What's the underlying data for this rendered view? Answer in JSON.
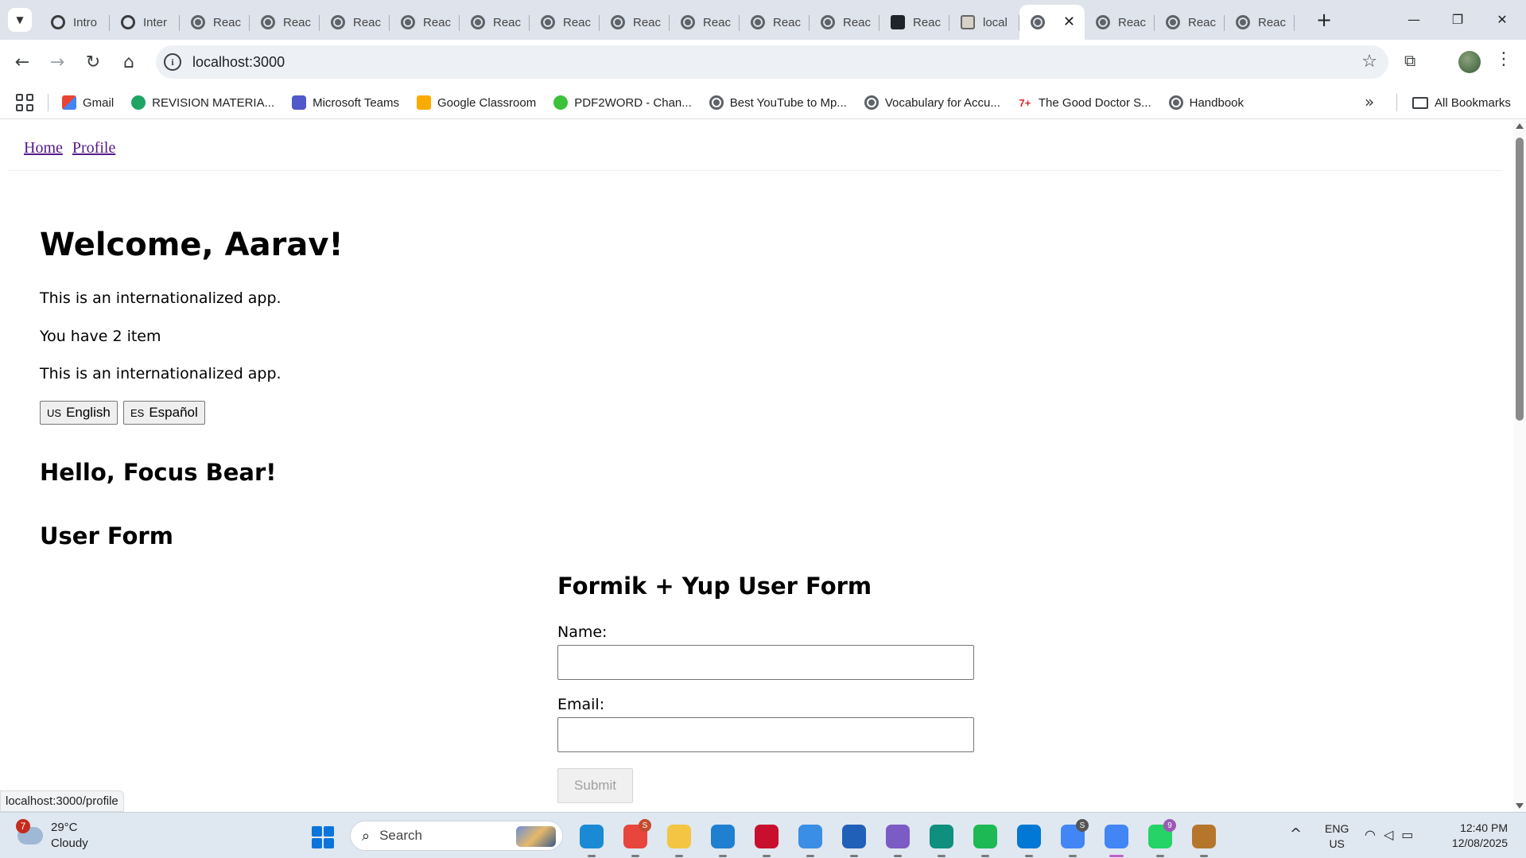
{
  "browser": {
    "tabs": [
      {
        "label": "Intro",
        "favicon": "openai-icon"
      },
      {
        "label": "Inter",
        "favicon": "openai-icon"
      },
      {
        "label": "Reac",
        "favicon": "globe-icon"
      },
      {
        "label": "Reac",
        "favicon": "globe-icon"
      },
      {
        "label": "Reac",
        "favicon": "globe-icon"
      },
      {
        "label": "Reac",
        "favicon": "globe-icon"
      },
      {
        "label": "Reac",
        "favicon": "globe-icon"
      },
      {
        "label": "Reac",
        "favicon": "globe-icon"
      },
      {
        "label": "Reac",
        "favicon": "globe-icon"
      },
      {
        "label": "Reac",
        "favicon": "globe-icon"
      },
      {
        "label": "Reac",
        "favicon": "globe-icon"
      },
      {
        "label": "Reac",
        "favicon": "globe-icon"
      },
      {
        "label": "Reac",
        "favicon": "react-icon"
      },
      {
        "label": "local",
        "favicon": "local-icon"
      },
      {
        "label": "",
        "favicon": "globe-icon",
        "active": true
      },
      {
        "label": "Reac",
        "favicon": "globe-icon"
      },
      {
        "label": "Reac",
        "favicon": "globe-icon"
      },
      {
        "label": "Reac",
        "favicon": "globe-icon"
      }
    ],
    "address": "localhost:3000",
    "bookmarks": [
      {
        "label": "Gmail",
        "icon": "gmail"
      },
      {
        "label": "REVISION MATERIA...",
        "icon": "green"
      },
      {
        "label": "Microsoft Teams",
        "icon": "teams"
      },
      {
        "label": "Google Classroom",
        "icon": "class"
      },
      {
        "label": "PDF2WORD - Chan...",
        "icon": "pdf"
      },
      {
        "label": "Best YouTube to Mp...",
        "icon": "world"
      },
      {
        "label": "Vocabulary for Accu...",
        "icon": "world"
      },
      {
        "label": "The Good Doctor S...",
        "icon": "tgd"
      },
      {
        "label": "Handbook",
        "icon": "world"
      }
    ],
    "all_bookmarks": "All Bookmarks",
    "status_url": "localhost:3000/profile"
  },
  "page": {
    "nav": {
      "home": "Home",
      "profile": "Profile"
    },
    "welcome": "Welcome, Aarav!",
    "intro": "This is an internationalized app.",
    "items": "You have 2 item",
    "intro2": "This is an internationalized app.",
    "lang_buttons": {
      "english": {
        "flag": "US",
        "label": "English"
      },
      "spanish": {
        "flag": "ES",
        "label": "Español"
      }
    },
    "hello": "Hello, Focus Bear!",
    "user_form_heading": "User Form",
    "form": {
      "title": "Formik + Yup User Form",
      "name_label": "Name:",
      "name_value": "",
      "email_label": "Email:",
      "email_value": "",
      "submit_label": "Submit"
    }
  },
  "taskbar": {
    "weather": {
      "temp": "29°C",
      "condition": "Cloudy",
      "badge": "7"
    },
    "search_placeholder": "Search",
    "apps": [
      {
        "name": "edge-icon",
        "color": "#1a8ad4"
      },
      {
        "name": "chrome-profile-icon",
        "color": "#e8453c",
        "badge": "S",
        "badge_color": "#c44a2f"
      },
      {
        "name": "file-explorer-icon",
        "color": "#f4c542"
      },
      {
        "name": "myhp-icon",
        "color": "#1f7fd1"
      },
      {
        "name": "mcafee-icon",
        "color": "#c8102e"
      },
      {
        "name": "copilot-icon",
        "color": "#3a8ee6"
      },
      {
        "name": "store-icon",
        "color": "#2160b8"
      },
      {
        "name": "snipping-tool-icon",
        "color": "#7b5cc4"
      },
      {
        "name": "sway-icon",
        "color": "#0f8f7e"
      },
      {
        "name": "spotify-icon",
        "color": "#1db954"
      },
      {
        "name": "vscode-icon",
        "color": "#0078d4"
      },
      {
        "name": "chrome-icon",
        "color": "#4285f4",
        "badge": "S",
        "badge_color": "#555555"
      },
      {
        "name": "chrome-active-icon",
        "color": "#4285f4",
        "active": true
      },
      {
        "name": "whatsapp-icon",
        "color": "#25d366",
        "badge": "9",
        "badge_color": "#9b59b6"
      },
      {
        "name": "focus-bear-icon",
        "color": "#b5762c"
      }
    ],
    "lang": {
      "line1": "ENG",
      "line2": "US"
    },
    "clock": {
      "time": "12:40 PM",
      "date": "12/08/2025"
    }
  }
}
